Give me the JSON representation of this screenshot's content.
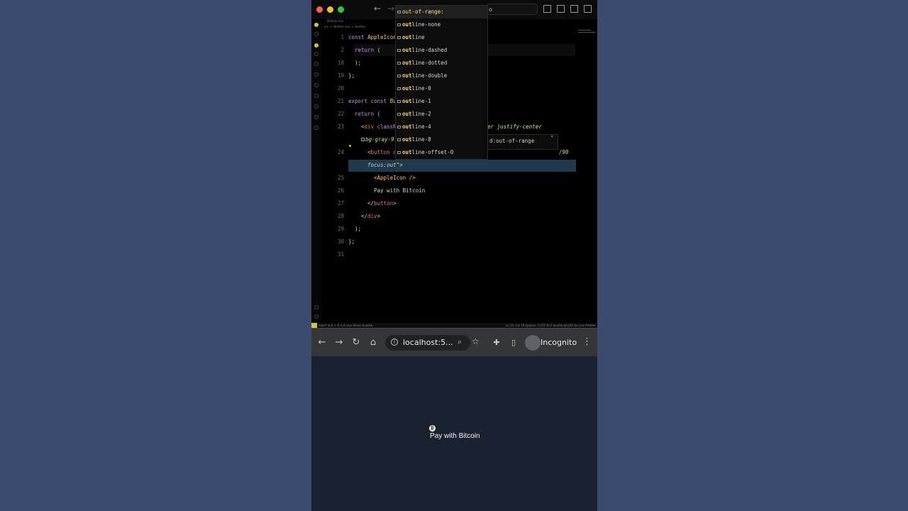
{
  "editor": {
    "command_center": "o",
    "breadcrumb_tab": "Button.tsx",
    "breadcrumb_path": "src > Button.tsx > Button",
    "line_numbers": [
      "1",
      "2",
      "18",
      "19",
      "20",
      "21",
      "22",
      "23",
      "",
      "24",
      "",
      "25",
      "26",
      "27",
      "28",
      "29",
      "30",
      "31"
    ],
    "code": {
      "l1_kw": "const",
      "l1_name": "AppleIcon",
      "l2_kw": "return",
      "l2_rest": " (",
      "l18": ");",
      "l19": "};",
      "l21_kw1": "export",
      "l21_kw2": "const",
      "l21_name": "Bu",
      "l22_kw": "return",
      "l22_rest": " (",
      "l23_open": "<",
      "l23_tag": "div",
      "l23_attr": " classN",
      "l23_tail": "er justify-center",
      "l23b": "bg-gray-9",
      "l24_open": "<",
      "l24_tag": "button",
      "l24_attr": " c",
      "l24_tail": "/90",
      "l24b_ghost": "focus:out",
      "l24b_end": "\">",
      "l25": "<AppleIcon />",
      "l26": "Pay with Bitcoin",
      "l27_open": "</",
      "l27_tag": "button",
      "l27_close": ">",
      "l28_open": "</",
      "l28_tag": "div",
      "l28_close": ">",
      "l29": ");",
      "l30": "};"
    },
    "suggestions": [
      {
        "match": "",
        "rest": "out-of-range:"
      },
      {
        "match": "out",
        "rest": "line-none"
      },
      {
        "match": "out",
        "rest": "line"
      },
      {
        "match": "out",
        "rest": "line-dashed"
      },
      {
        "match": "out",
        "rest": "line-dotted"
      },
      {
        "match": "out",
        "rest": "line-double"
      },
      {
        "match": "out",
        "rest": "line-0"
      },
      {
        "match": "out",
        "rest": "line-1"
      },
      {
        "match": "out",
        "rest": "line-2"
      },
      {
        "match": "out",
        "rest": "line-4"
      },
      {
        "match": "out",
        "rest": "line-8"
      },
      {
        "match": "out",
        "rest": "line-offset-0"
      }
    ],
    "detail_text": "d:out-of-range",
    "statusbar_left": "main*  ⊗ 0 ⚠ 0  ⟲ 0  Live Share  Quokka",
    "statusbar_right": "Ln 24, Col 79  Spaces: 2  UTF-8  LF  JavaScript JSX  Go Live  Prettier"
  },
  "browser": {
    "url": "localhost:5...",
    "profile_label": "Incognito",
    "button_icon_glyph": "₿",
    "button_label": "Pay with Bitcoin"
  }
}
